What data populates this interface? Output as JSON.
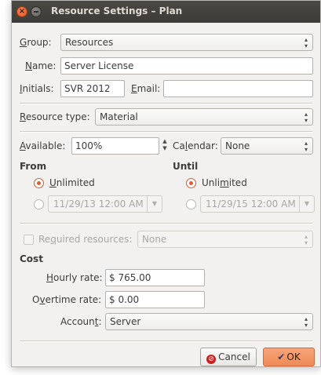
{
  "window": {
    "title": "Resource Settings – Plan",
    "close_glyph": "×"
  },
  "icons": {
    "combo_arrows": "⌃⌄",
    "dropdown": "▼",
    "spin_up": "▲",
    "spin_down": "▼",
    "cancel": "⊘",
    "ok": "✔"
  },
  "form": {
    "group": {
      "label_pre": "",
      "label_u": "G",
      "label_post": "roup:",
      "value": "Resources"
    },
    "name": {
      "label_u": "N",
      "label_post": "ame:",
      "value": "Server License"
    },
    "initials": {
      "label_u": "I",
      "label_post": "nitials:",
      "value": "SVR 2012"
    },
    "email": {
      "label_u": "E",
      "label_post": "mail:",
      "value": ""
    },
    "resource_type": {
      "label_u": "R",
      "label_post": "esource type:",
      "value": "Material"
    },
    "available": {
      "label_u": "A",
      "label_post": "vailable:",
      "value": "100%"
    },
    "calendar": {
      "label_pre": "Ca",
      "label_u": "l",
      "label_post": "endar:",
      "value": "None"
    }
  },
  "from": {
    "heading": "From",
    "unlimited": {
      "label_u": "U",
      "label_post": "nlimited",
      "selected": true
    },
    "datetime": "11/29/13 12:00 AM"
  },
  "until": {
    "heading": "Until",
    "unlimited": {
      "label_pre": "Unli",
      "label_u": "m",
      "label_post": "ited",
      "selected": true
    },
    "datetime": "11/29/15 12:00 AM"
  },
  "required": {
    "label_pre": "Re",
    "label_u": "q",
    "label_post": "uired resources:",
    "value": "None",
    "checked": false
  },
  "cost": {
    "heading": "Cost",
    "hourly": {
      "label_u": "H",
      "label_post": "ourly rate:",
      "value": "$ 765.00"
    },
    "overtime": {
      "label_pre": "O",
      "label_u": "v",
      "label_post": "ertime rate:",
      "value": "$ 0.00"
    },
    "account": {
      "label_pre": "Accoun",
      "label_u": "t",
      "label_post": ":",
      "value": "Server"
    }
  },
  "buttons": {
    "cancel": {
      "label_u": "C",
      "label_post": "ancel"
    },
    "ok": {
      "label_u": "O",
      "label_post": "K"
    }
  },
  "colors": {
    "accent": "#e35e2c",
    "titlebar": "#3c3b37",
    "window_bg": "#f2f1f0"
  }
}
